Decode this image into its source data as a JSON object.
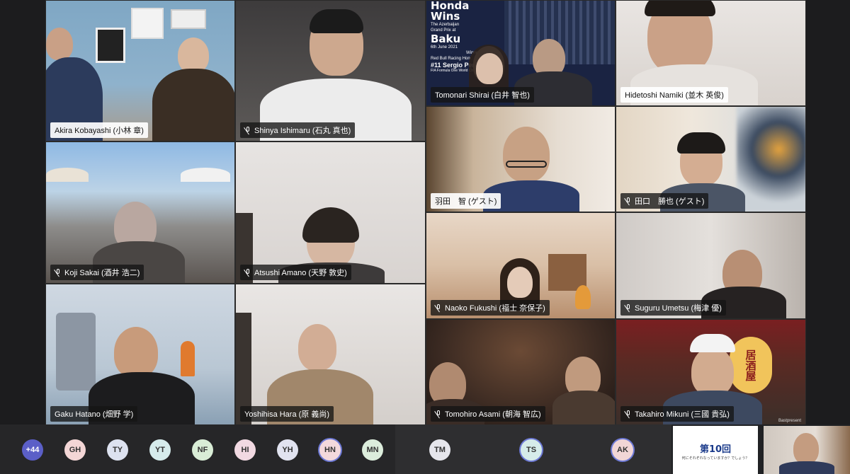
{
  "participants": [
    {
      "id": "akira",
      "name": "Akira Kobayashi (小林 章)"
    },
    {
      "id": "shinya",
      "name": "Shinya Ishimaru (石丸 真也)"
    },
    {
      "id": "tomonari",
      "name": "Tomonari Shirai (白井 智也)"
    },
    {
      "id": "hidetoshi",
      "name": "Hidetoshi Namiki (並木 英俊)"
    },
    {
      "id": "koji",
      "name": "Koji Sakai (酒井 浩二)"
    },
    {
      "id": "atsushi",
      "name": "Atsushi Amano (天野 敦史)"
    },
    {
      "id": "haneda",
      "name": "羽田　智 (ゲスト)"
    },
    {
      "id": "taguchi",
      "name": "田口　勝也 (ゲスト)"
    },
    {
      "id": "naoko",
      "name": "Naoko Fukushi (福士 奈保子)"
    },
    {
      "id": "suguru",
      "name": "Suguru Umetsu (梅津 優)"
    },
    {
      "id": "gaku",
      "name": "Gaku Hatano (畑野 学)"
    },
    {
      "id": "yoshihisa",
      "name": "Yoshihisa Hara (原 義尚)"
    },
    {
      "id": "tomohiro",
      "name": "Tomohiro Asami (朝海 智広)"
    },
    {
      "id": "takahiro",
      "name": "Takahiro Mikuni (三國 貴弘)"
    }
  ],
  "background_poster": {
    "line1": "Honda",
    "line2": "Wins",
    "line3": "The Azerbaijan",
    "line4": "Grand Prix at",
    "line5": "Baku",
    "line6": "6th June 2021",
    "line7": "Winner",
    "line8": "Red Bull Racing Hon",
    "line9": "#11 Sergio Pere",
    "line10": "FIA Formula One World Championshi"
  },
  "lantern_text": "居酒屋",
  "lantern_watermark": "Bastpresent",
  "bottom_bar": {
    "overflow_count": "+44",
    "avatars": [
      {
        "initials": "GH",
        "color": "#f3d6d6"
      },
      {
        "initials": "TY",
        "color": "#dde2f0"
      },
      {
        "initials": "YT",
        "color": "#d6ecec"
      },
      {
        "initials": "NF",
        "color": "#d9edd6"
      },
      {
        "initials": "HI",
        "color": "#f1d9e2"
      },
      {
        "initials": "YH",
        "color": "#e1e3f0"
      },
      {
        "initials": "HN",
        "color": "#f3d9dc"
      },
      {
        "initials": "MN",
        "color": "#dceddc"
      }
    ],
    "mid_avatars": [
      {
        "initials": "TM",
        "color": "#e6e6ec"
      },
      {
        "initials": "TS",
        "color": "#d6ecea"
      },
      {
        "initials": "AK",
        "color": "#f1d6d6"
      }
    ],
    "slide": {
      "title": "第10回",
      "subtitle": "何にそれぞれなっていますか？でしょう？"
    }
  },
  "colors": {
    "overflow": "#5b5fc7",
    "ring": "#6e7ad6",
    "bar": "#202124"
  }
}
